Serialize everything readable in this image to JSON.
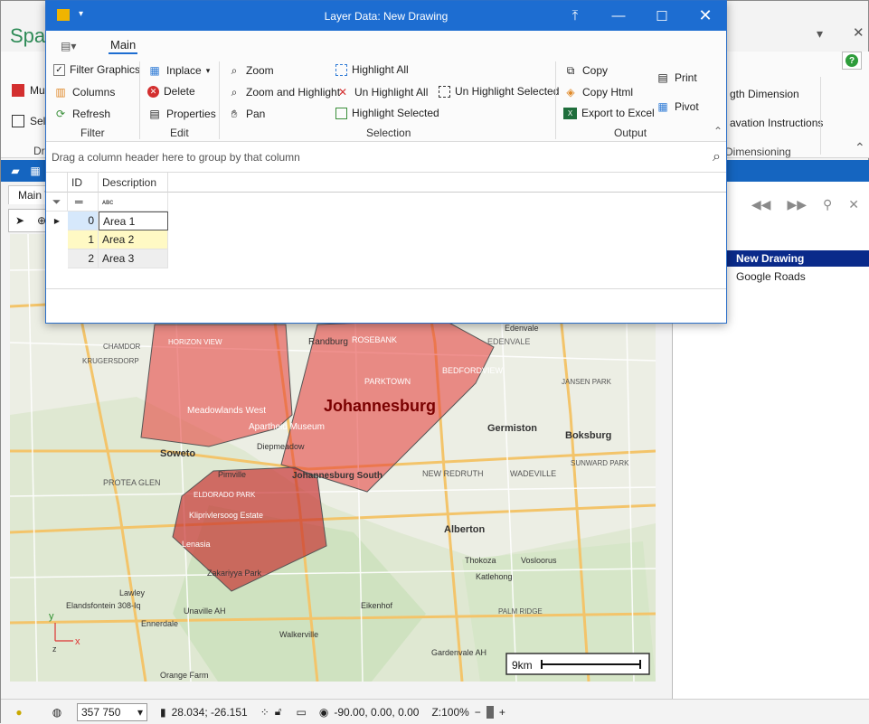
{
  "app": {
    "title_partial": "Spat",
    "ribbon_left": [
      "Mul",
      "Sel"
    ],
    "ribbon_left_group": "Dra",
    "ribbon_right": [
      "gth Dimension",
      "avation Instructions",
      "Dimensioning"
    ],
    "main_view_tab": "Main V"
  },
  "dialog": {
    "title": "Layer Data: New Drawing",
    "ribbon_tab": "Main",
    "groups": {
      "filter": {
        "label": "Filter",
        "items": [
          "Filter Graphics",
          "Columns",
          "Refresh"
        ]
      },
      "edit": {
        "label": "Edit",
        "items": [
          "Inplace",
          "Delete",
          "Properties"
        ]
      },
      "selection": {
        "label": "Selection",
        "items": [
          "Zoom",
          "Zoom and Highlight",
          "Pan",
          "Highlight All",
          "Un Highlight All",
          "Highlight Selected",
          "Un Highlight Selected"
        ]
      },
      "output": {
        "label": "Output",
        "items": [
          "Copy",
          "Copy Html",
          "Export to Excel",
          "Print",
          "Pivot"
        ]
      }
    },
    "group_panel_hint": "Drag a column header here to group by that column",
    "grid": {
      "columns": [
        "ID",
        "Description"
      ],
      "rows": [
        {
          "id": "0",
          "description": "Area 1"
        },
        {
          "id": "1",
          "description": "Area 2"
        },
        {
          "id": "2",
          "description": "Area 3"
        }
      ]
    }
  },
  "map": {
    "places": [
      "Randburg",
      "ROSEBANK",
      "Edenvale",
      "EDENVALE",
      "CHAMDOR",
      "HORIZON VIEW",
      "KRUGERSDORP",
      "PARKTOWN",
      "BEDFORDVIEW",
      "Johannesburg",
      "Meadowlands West",
      "Apartheid Museum",
      "Diepmeadow",
      "Germiston",
      "Boksburg",
      "Soweto",
      "Johannesburg South",
      "NEW REDRUTH",
      "WADEVILLE",
      "SUNWARD PARK",
      "PROTEA GLEN",
      "Pimville",
      "ELDORADO PARK",
      "Kliprivlersoog Estate",
      "Lenasia",
      "Alberton",
      "Thokoza",
      "Vosloorus",
      "Katlehong",
      "Zakariyya Park",
      "Lawley",
      "PALM RIDGE",
      "Elandsfontein 308-Iq",
      "Ennerdale",
      "Eikenhof",
      "Unaville AH",
      "Walkerville",
      "Gardenvale AH",
      "Orange Farm",
      "JANSEN PARK"
    ],
    "scale_label": "9km",
    "axis_y": "y",
    "axis_x": "x",
    "axis_z": "z"
  },
  "right_panel": {
    "layers": [
      {
        "name": "New Drawing",
        "selected": true
      },
      {
        "name": "Google Roads",
        "selected": false
      }
    ]
  },
  "status": {
    "scale": "357 750",
    "coords": "28.034; -26.151",
    "rotation": "-90.00, 0.00, 0.00",
    "zoom": "Z:100%"
  }
}
